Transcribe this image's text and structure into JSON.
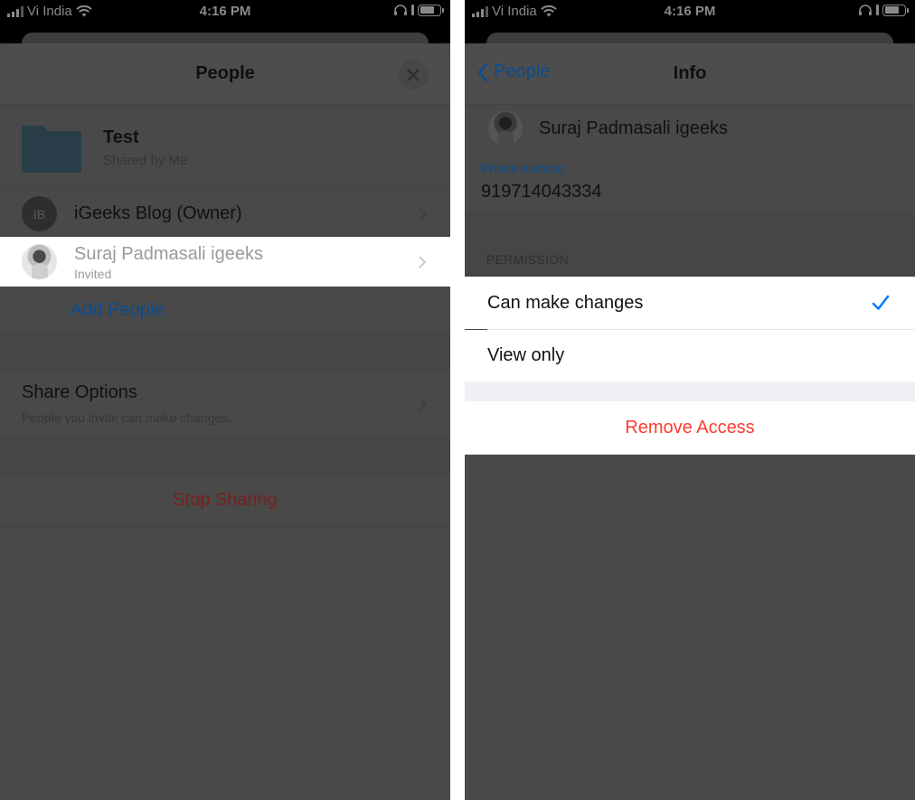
{
  "status_bar": {
    "carrier": "Vi India",
    "time": "4:16 PM",
    "icons": [
      "signal-icon",
      "wifi-icon",
      "headphones-icon",
      "battery-icon"
    ]
  },
  "left_screen": {
    "title": "People",
    "close_icon": "close-icon",
    "folder": {
      "name": "Test",
      "subtitle": "Shared by Me",
      "icon": "folder-icon"
    },
    "people": [
      {
        "initials": "IB",
        "name": "iGeeks Blog (Owner)",
        "status": ""
      },
      {
        "initials": "",
        "name": "Suraj Padmasali igeeks",
        "status": "Invited",
        "highlighted": true
      }
    ],
    "add_people": "Add People",
    "share_options": {
      "title": "Share Options",
      "subtitle": "People you invite can make changes."
    },
    "stop_sharing": "Stop Sharing"
  },
  "right_screen": {
    "back_label": "People",
    "title": "Info",
    "contact_name": "Suraj Padmasali igeeks",
    "phone_label": "Phone number",
    "phone_value": "919714043334",
    "permission_header": "PERMISSION",
    "permissions": [
      {
        "label": "Can make changes",
        "selected": true
      },
      {
        "label": "View only",
        "selected": false
      }
    ],
    "remove_access": "Remove Access"
  },
  "colors": {
    "accent_blue": "#0a7aff",
    "destructive_red": "#ff3b30",
    "dim_overlay": "#494949"
  }
}
